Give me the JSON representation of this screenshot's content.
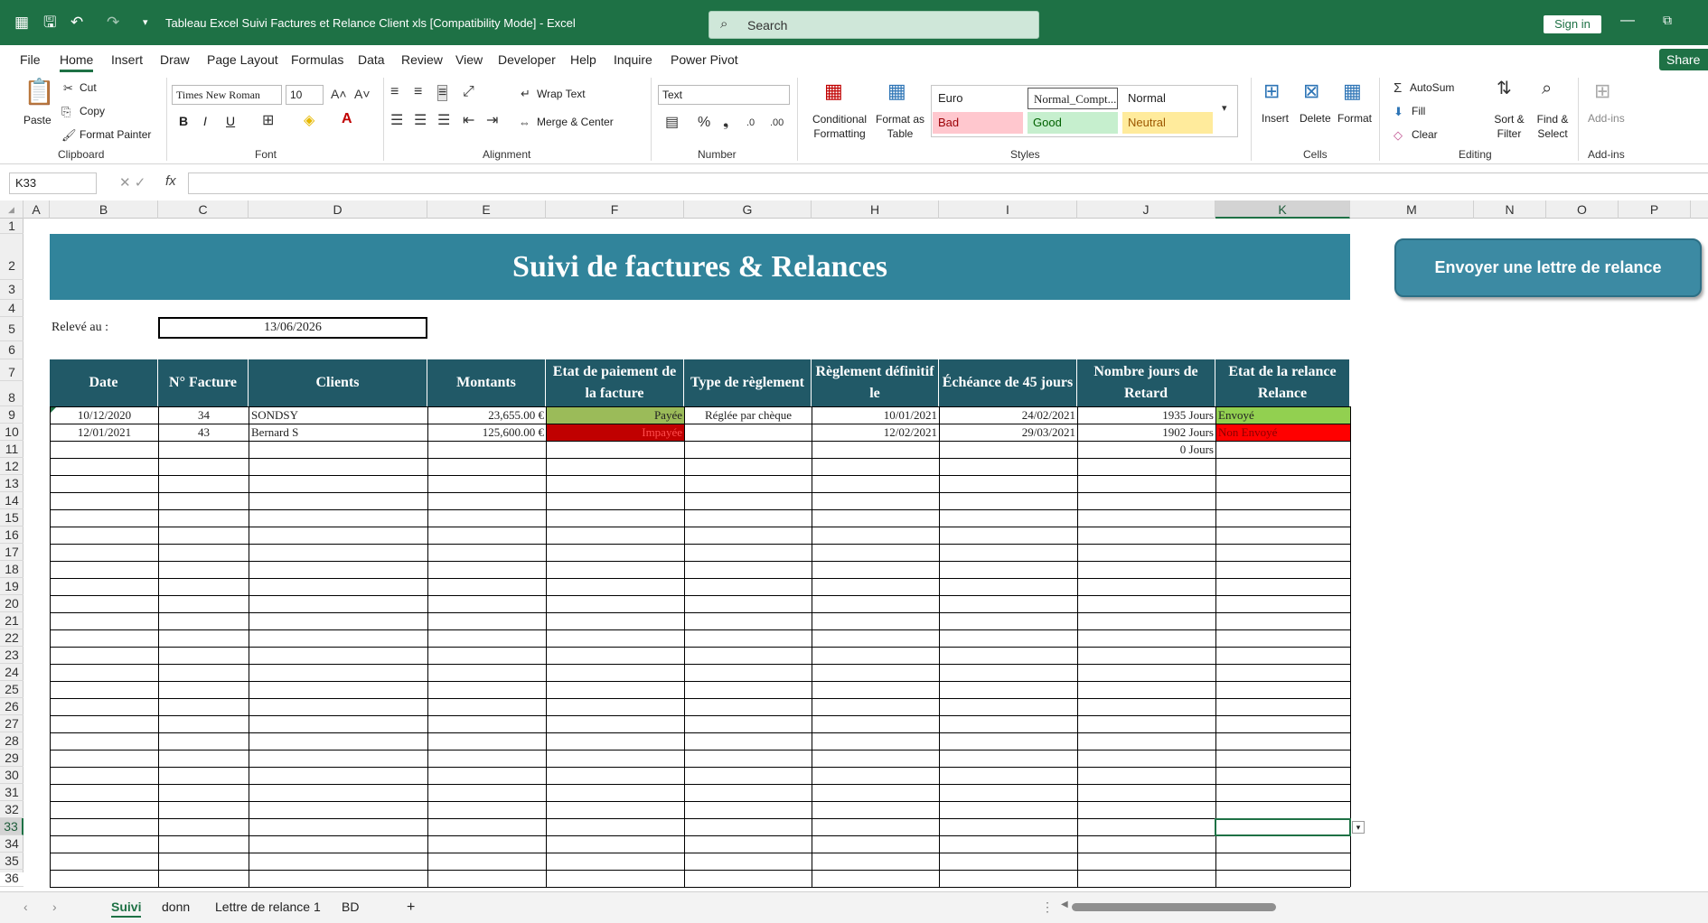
{
  "window": {
    "title": "Tableau Excel Suivi Factures et Relance Client xls  [Compatibility Mode]  -  Excel",
    "search_placeholder": "Search",
    "signin": "Sign in"
  },
  "menu": [
    "File",
    "Home",
    "Insert",
    "Draw",
    "Page Layout",
    "Formulas",
    "Data",
    "Review",
    "View",
    "Developer",
    "Help",
    "Inquire",
    "Power Pivot"
  ],
  "share": "Share",
  "ribbon": {
    "clipboard": {
      "paste": "Paste",
      "cut": "Cut",
      "copy": "Copy",
      "format_painter": "Format Painter",
      "label": "Clipboard"
    },
    "font": {
      "name": "Times New Roman",
      "size": "10",
      "bold": "B",
      "italic": "I",
      "underline": "U",
      "label": "Font"
    },
    "alignment": {
      "wrap": "Wrap Text",
      "merge": "Merge & Center",
      "label": "Alignment"
    },
    "number": {
      "format": "Text",
      "label": "Number"
    },
    "styles": {
      "conditional": "Conditional Formatting",
      "format_table": "Format as Table",
      "cells": [
        {
          "label": "Euro",
          "bg": "#ffffff",
          "color": "#000000"
        },
        {
          "label": "Normal_Compt...",
          "bg": "#ffffff",
          "color": "#000000"
        },
        {
          "label": "Normal",
          "bg": "#ffffff",
          "color": "#000000"
        },
        {
          "label": "Bad",
          "bg": "#ffc7ce",
          "color": "#9c0006"
        },
        {
          "label": "Good",
          "bg": "#c6efce",
          "color": "#006100"
        },
        {
          "label": "Neutral",
          "bg": "#ffeb9c",
          "color": "#9c5700"
        }
      ],
      "label": "Styles"
    },
    "cells": {
      "insert": "Insert",
      "delete": "Delete",
      "format": "Format",
      "label": "Cells"
    },
    "editing": {
      "autosum": "AutoSum",
      "fill": "Fill",
      "clear": "Clear",
      "sort": "Sort & Filter",
      "find": "Find & Select",
      "label": "Editing"
    },
    "addins": {
      "addins": "Add-ins",
      "label": "Add-ins"
    }
  },
  "formula_bar": {
    "name_box": "K33",
    "value": ""
  },
  "columns": [
    "A",
    "B",
    "C",
    "D",
    "E",
    "F",
    "G",
    "H",
    "I",
    "J",
    "K",
    "M",
    "N",
    "O",
    "P"
  ],
  "selected_column": "K",
  "selected_row": "33",
  "sheet": {
    "banner_title": "Suivi de factures & Relances",
    "button": "Envoyer une lettre de relance",
    "releve_label": "Relevé au :",
    "releve_date": "13/06/2026",
    "headers": [
      "Date",
      "N° Facture",
      "Clients",
      "Montants",
      "Etat de paiement de la facture",
      "Type de règlement",
      "Règlement définitif le",
      "Échéance de 45 jours",
      "Nombre jours de Retard",
      "Etat de la relance Relance"
    ],
    "rows": [
      {
        "date": "10/12/2020",
        "facture": "34",
        "client": "SONDSY",
        "montant": "23,655.00 €",
        "etat": "Payée",
        "type": "Réglée par chèque",
        "reglement": "10/01/2021",
        "echeance": "24/02/2021",
        "retard": "1935 Jours",
        "relance": "Envoyé"
      },
      {
        "date": "12/01/2021",
        "facture": "43",
        "client": "Bernard S",
        "montant": "125,600.00 €",
        "etat": "Impayée",
        "type": "",
        "reglement": "12/02/2021",
        "echeance": "29/03/2021",
        "retard": "1902 Jours",
        "relance": "Non Envoyé"
      },
      {
        "date": "",
        "facture": "",
        "client": "",
        "montant": "",
        "etat": "",
        "type": "",
        "reglement": "",
        "echeance": "",
        "retard": "0 Jours",
        "relance": ""
      }
    ],
    "colors": {
      "banner": "#31849b",
      "header": "#215967",
      "paid": "#9bbb59",
      "unpaid": "#c00000",
      "sent": "#92d050",
      "not_sent": "#ff0000",
      "excel_green": "#1e7145"
    }
  },
  "sheet_tabs": [
    "Suivi",
    "donn",
    "Lettre de relance 1",
    "BD"
  ],
  "active_sheet": "Suivi"
}
